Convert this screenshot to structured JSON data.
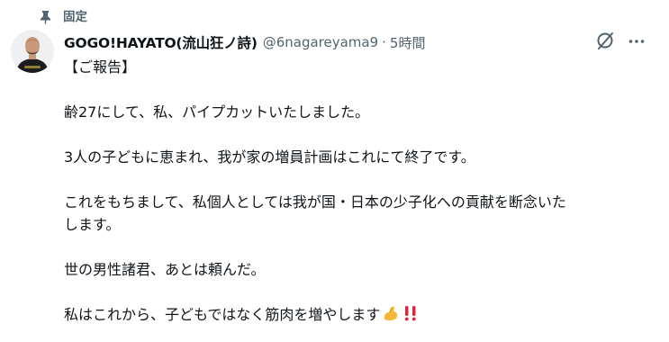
{
  "pinned": {
    "label": "固定",
    "icon": "pin-icon"
  },
  "author": {
    "display_name": "GOGO!HAYATO(流山狂ノ詩)",
    "handle": "@6nagareyama9",
    "separator": "·",
    "time": "5時間"
  },
  "actions": {
    "grok_icon": "grok-icon",
    "more_icon": "more-icon"
  },
  "post": {
    "line1": "【ご報告】",
    "line2": "齢27にして、私、パイプカットいたしました。",
    "line3": "3人の子どもに恵まれ、我が家の増員計画はこれにて終了です。",
    "line4": "これをもちまして、私個人としては我が国・日本の少子化への貢献を断念いたします。",
    "line5": "世の男性諸君、あとは頼んだ。",
    "line6": "私はこれから、子どもではなく筋肉を増やします",
    "emojis": [
      "flexed-biceps-emoji",
      "double-exclamation-emoji"
    ]
  }
}
